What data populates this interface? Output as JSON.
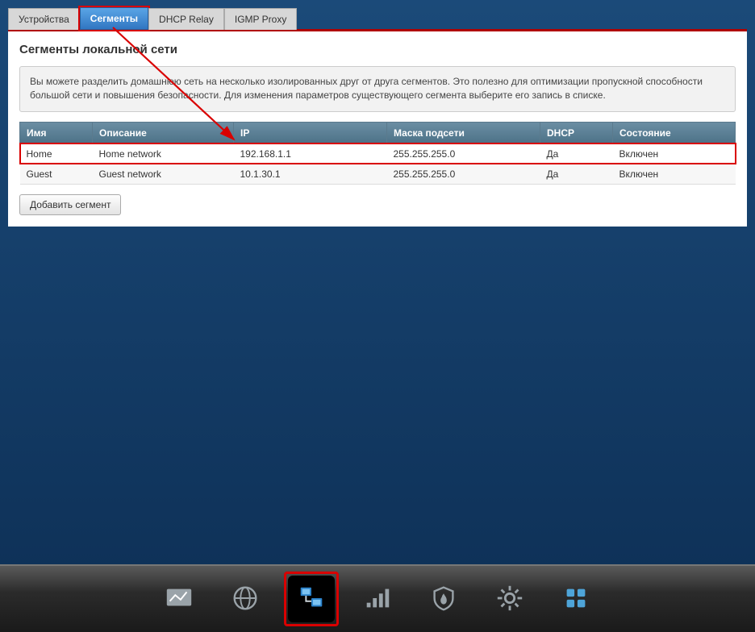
{
  "tabs": [
    {
      "label": "Устройства"
    },
    {
      "label": "Сегменты",
      "active": true,
      "highlighted": true
    },
    {
      "label": "DHCP Relay"
    },
    {
      "label": "IGMP Proxy"
    }
  ],
  "page_title": "Сегменты локальной сети",
  "info_text": "Вы можете разделить домашнюю сеть на несколько изолированных друг от друга сегментов. Это полезно для оптимизации пропускной способности большой сети и повышения безопасности. Для изменения параметров существующего сегмента выберите его запись в списке.",
  "table": {
    "columns": [
      "Имя",
      "Описание",
      "IP",
      "Маска подсети",
      "DHCP",
      "Состояние"
    ],
    "rows": [
      {
        "name": "Home",
        "desc": "Home network",
        "ip": "192.168.1.1",
        "mask": "255.255.255.0",
        "dhcp": "Да",
        "state": "Включен",
        "highlighted": true
      },
      {
        "name": "Guest",
        "desc": "Guest network",
        "ip": "10.1.30.1",
        "mask": "255.255.255.0",
        "dhcp": "Да",
        "state": "Включен"
      }
    ]
  },
  "add_button": "Добавить сегмент",
  "dock": {
    "items": [
      {
        "name": "dashboard-icon"
      },
      {
        "name": "globe-icon"
      },
      {
        "name": "network-icon",
        "active": true,
        "highlighted": true
      },
      {
        "name": "signal-icon"
      },
      {
        "name": "firewall-icon"
      },
      {
        "name": "gear-icon"
      },
      {
        "name": "apps-icon"
      }
    ]
  }
}
